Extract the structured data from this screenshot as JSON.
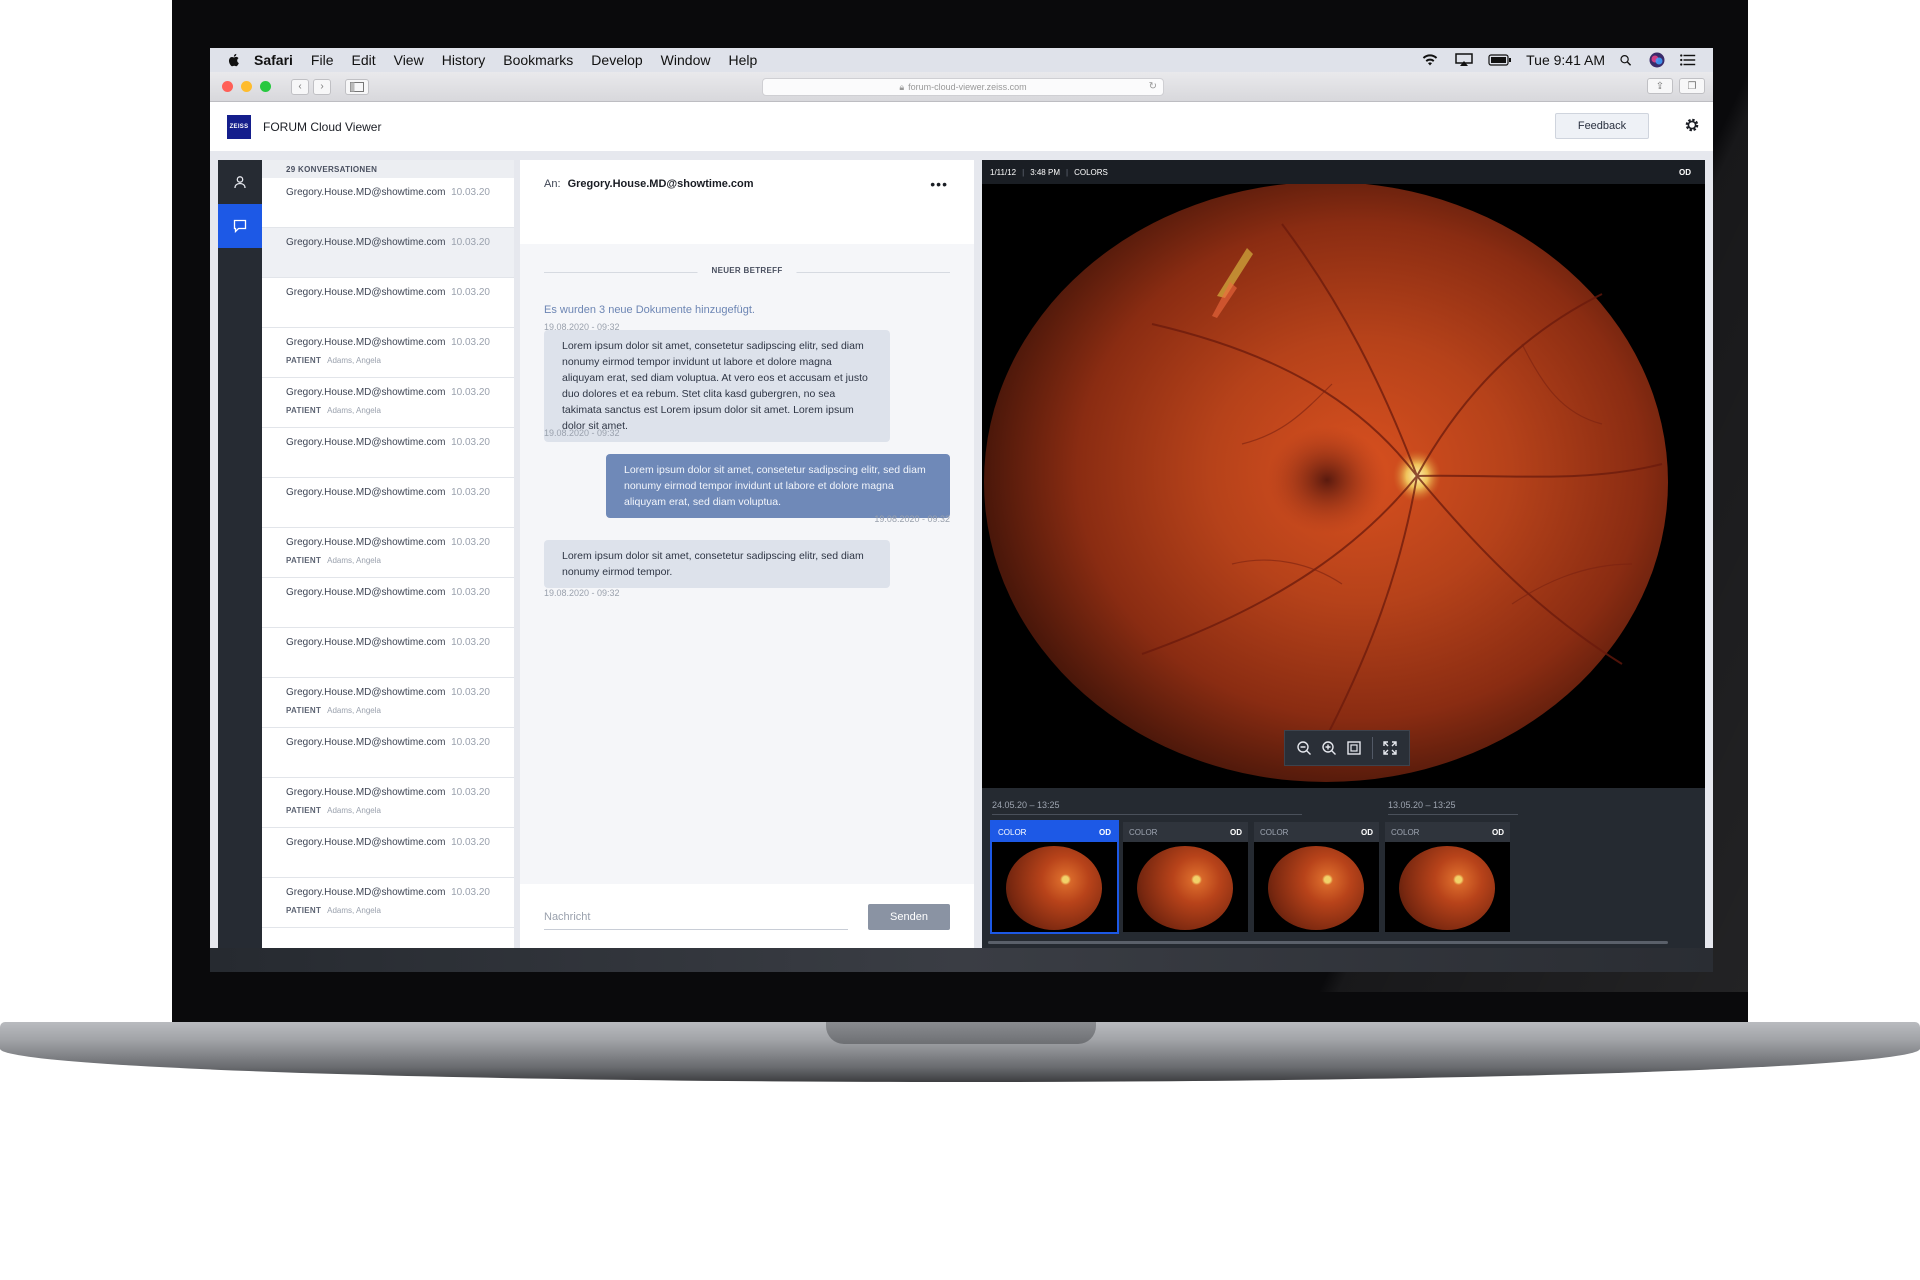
{
  "menubar": {
    "items": [
      "Safari",
      "File",
      "Edit",
      "View",
      "History",
      "Bookmarks",
      "Develop",
      "Window",
      "Help"
    ],
    "clock": "Tue 9:41 AM"
  },
  "safari": {
    "url": "forum-cloud-viewer.zeiss.com"
  },
  "header": {
    "logo": "ZEISS",
    "title": "FORUM Cloud Viewer",
    "feedback": "Feedback"
  },
  "conversations": {
    "count_label": "29 KONVERSATIONEN",
    "patient_label": "PATIENT",
    "items": [
      {
        "from": "Gregory.House.MD@showtime.com",
        "date": "10.03.20",
        "patient": ""
      },
      {
        "from": "Gregory.House.MD@showtime.com",
        "date": "10.03.20",
        "patient": ""
      },
      {
        "from": "Gregory.House.MD@showtime.com",
        "date": "10.03.20",
        "patient": ""
      },
      {
        "from": "Gregory.House.MD@showtime.com",
        "date": "10.03.20",
        "patient": "Adams, Angela"
      },
      {
        "from": "Gregory.House.MD@showtime.com",
        "date": "10.03.20",
        "patient": "Adams, Angela"
      },
      {
        "from": "Gregory.House.MD@showtime.com",
        "date": "10.03.20",
        "patient": ""
      },
      {
        "from": "Gregory.House.MD@showtime.com",
        "date": "10.03.20",
        "patient": ""
      },
      {
        "from": "Gregory.House.MD@showtime.com",
        "date": "10.03.20",
        "patient": "Adams, Angela"
      },
      {
        "from": "Gregory.House.MD@showtime.com",
        "date": "10.03.20",
        "patient": ""
      },
      {
        "from": "Gregory.House.MD@showtime.com",
        "date": "10.03.20",
        "patient": ""
      },
      {
        "from": "Gregory.House.MD@showtime.com",
        "date": "10.03.20",
        "patient": "Adams, Angela"
      },
      {
        "from": "Gregory.House.MD@showtime.com",
        "date": "10.03.20",
        "patient": ""
      },
      {
        "from": "Gregory.House.MD@showtime.com",
        "date": "10.03.20",
        "patient": "Adams, Angela"
      },
      {
        "from": "Gregory.House.MD@showtime.com",
        "date": "10.03.20",
        "patient": ""
      },
      {
        "from": "Gregory.House.MD@showtime.com",
        "date": "10.03.20",
        "patient": "Adams, Angela"
      }
    ]
  },
  "message": {
    "to_label": "An:",
    "to": "Gregory.House.MD@showtime.com",
    "more": "•••",
    "subject_divider": "NEUER BETREFF",
    "system_text": "Es wurden 3 neue Dokumente hinzugefügt.",
    "system_date": "19.08.2020 - 09:32",
    "bubbles": [
      {
        "text": "Lorem ipsum dolor sit amet, consetetur sadipscing elitr, sed diam nonumy eirmod tempor invidunt ut labore et dolore magna aliquyam erat, sed diam voluptua. At vero eos et accusam et justo duo dolores et ea rebum. Stet clita kasd gubergren, no sea takimata sanctus est Lorem ipsum dolor sit amet. Lorem ipsum dolor sit amet.",
        "date": "19.08.2020 - 09:32"
      },
      {
        "text": "Lorem ipsum dolor sit amet, consetetur sadipscing elitr, sed diam nonumy eirmod tempor invidunt ut labore et dolore magna aliquyam erat, sed diam voluptua.",
        "date": "19.08.2020 - 09:32"
      },
      {
        "text": "Lorem ipsum dolor sit amet, consetetur sadipscing elitr, sed diam nonumy eirmod tempor.",
        "date": "19.08.2020 - 09:32"
      }
    ],
    "input_placeholder": "Nachricht",
    "send": "Senden"
  },
  "viewer": {
    "date": "1/11/12",
    "time": "3:48 PM",
    "mode": "COLORS",
    "eye": "OD",
    "groups": [
      "24.05.20 – 13:25",
      "13.05.20 – 13:25"
    ],
    "thumbs": [
      {
        "label": "COLOR",
        "eye": "OD"
      },
      {
        "label": "COLOR",
        "eye": "OD"
      },
      {
        "label": "COLOR",
        "eye": "OD"
      },
      {
        "label": "COLOR",
        "eye": "OD"
      }
    ]
  },
  "colors": {
    "accent": "#1d59e6",
    "nav_dark": "#262b33",
    "bubble_out": "#6f89b8",
    "bubble_in": "#dde2eb"
  }
}
